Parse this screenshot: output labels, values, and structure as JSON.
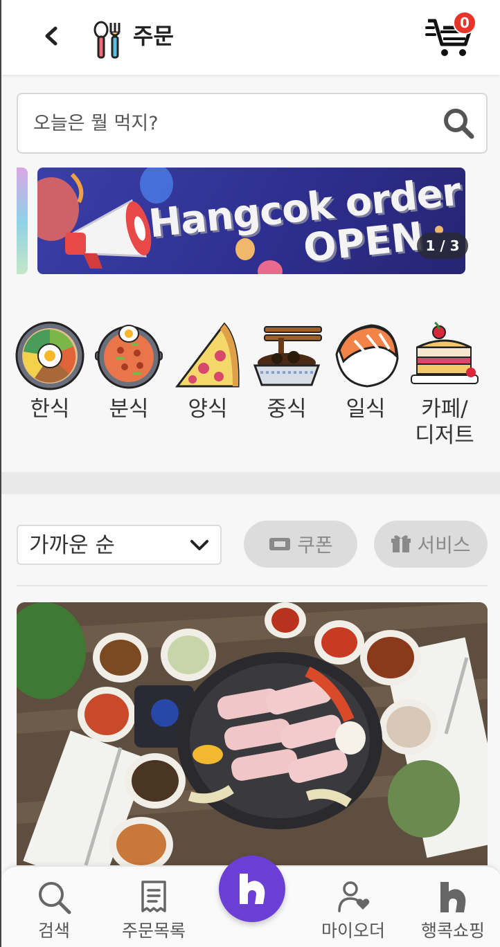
{
  "header": {
    "title": "주문",
    "cart_count": "0"
  },
  "search": {
    "placeholder": "오늘은 뭘 먹지?"
  },
  "banner": {
    "line1": "Hangcok order",
    "line2": "OPEN",
    "counter": "1 / 3"
  },
  "categories": [
    {
      "label": "한식",
      "icon": "bibimbap-icon"
    },
    {
      "label": "분식",
      "icon": "tteokbokki-icon"
    },
    {
      "label": "양식",
      "icon": "pizza-icon"
    },
    {
      "label": "중식",
      "icon": "noodles-icon"
    },
    {
      "label": "일식",
      "icon": "sushi-icon"
    },
    {
      "label": "카페/\n디저트",
      "icon": "cake-icon"
    }
  ],
  "filters": {
    "sort_selected": "가까운 순",
    "coupon_label": "쿠폰",
    "service_label": "서비스"
  },
  "bottom_nav": {
    "search": "검색",
    "orders": "주문목록",
    "my_order": "마이오더",
    "shopping": "행콕쇼핑"
  },
  "colors": {
    "accent": "#6a3fd6",
    "badge": "#e8332a",
    "banner_bg": "#2e2f8f"
  }
}
